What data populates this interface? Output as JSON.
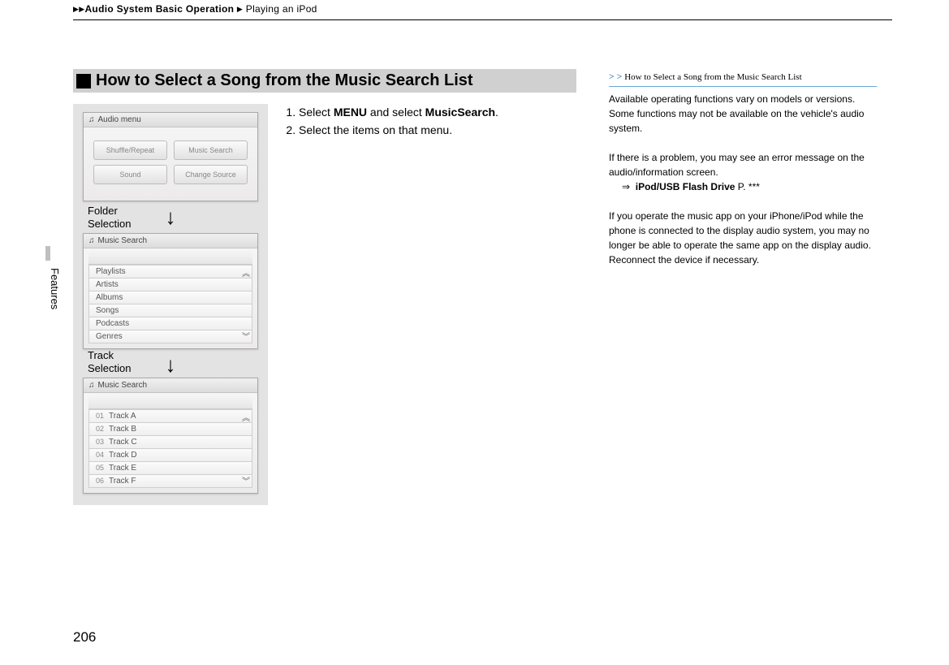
{
  "breadcrumb": {
    "section": "Audio System Basic Operation",
    "sub": "Playing an iPod"
  },
  "sideTab": "Features",
  "pageNumber": "206",
  "section": {
    "title": "How to Select a Song from the Music Search List",
    "steps": {
      "s1_a": "Select ",
      "s1_b": "MENU",
      "s1_c": " and select ",
      "s1_d": "MusicSearch",
      "s1_e": ".",
      "s2": "Select the items on that menu."
    },
    "labels": {
      "folder": "Folder\nSelection",
      "track": "Track\nSelection"
    },
    "screen1": {
      "title": "Audio menu",
      "buttons": [
        "Shuffle/Repeat",
        "Music Search",
        "Sound",
        "Change Source"
      ]
    },
    "screen2": {
      "title": "Music Search",
      "items": [
        "Playlists",
        "Artists",
        "Albums",
        "Songs",
        "Podcasts",
        "Genres"
      ]
    },
    "screen3": {
      "title": "Music Search",
      "tracks": [
        {
          "n": "01",
          "t": "Track A"
        },
        {
          "n": "02",
          "t": "Track B"
        },
        {
          "n": "03",
          "t": "Track C"
        },
        {
          "n": "04",
          "t": "Track D"
        },
        {
          "n": "05",
          "t": "Track E"
        },
        {
          "n": "06",
          "t": "Track F"
        }
      ]
    }
  },
  "right": {
    "head": "How to Select a Song from the Music Search List",
    "p1": "Available operating functions vary on models or versions. Some functions may not be available on the vehicle's audio system.",
    "p2": "If there is a problem, you may see an error message on the audio/information screen.",
    "p2_link": "iPod/USB Flash Drive",
    "p2_page": " P. ***",
    "p3": "If you operate the music app on your iPhone/iPod while the phone is connected to the display audio system, you may no longer be able to operate the same app on the display audio. Reconnect the device if necessary."
  }
}
